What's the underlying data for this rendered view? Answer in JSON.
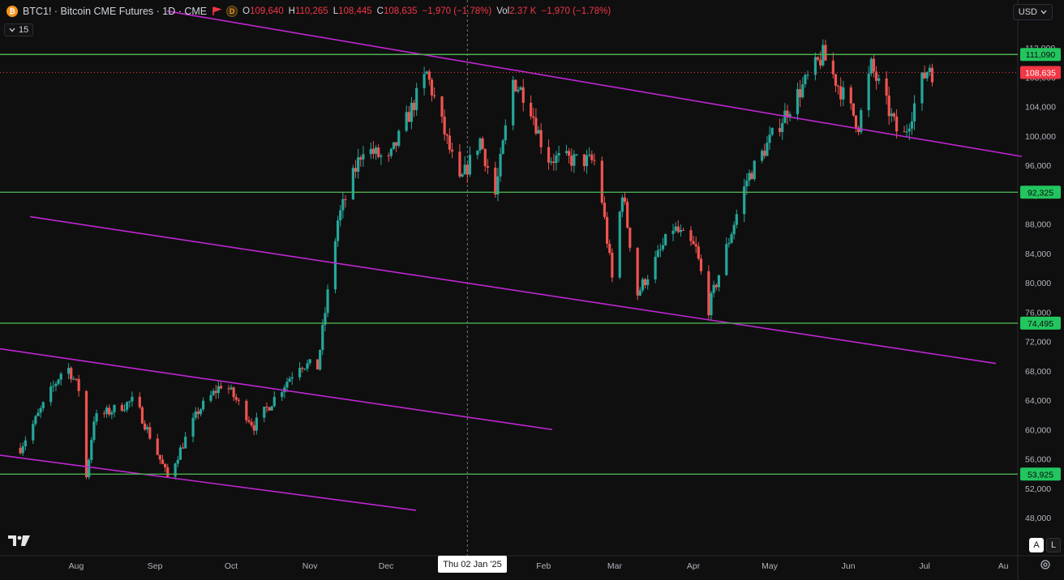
{
  "header": {
    "symbol_title": "BTC1! · Bitcoin CME Futures · 1D · CME",
    "coin_badge": "₿",
    "d_badge": "D",
    "open_label": "O",
    "open_value": "109,640",
    "high_label": "H",
    "high_value": "110,265",
    "low_label": "L",
    "low_value": "108,445",
    "close_label": "C",
    "close_value": "108,635",
    "change": "−1,970 (−1.78%)",
    "vol_label": "Vol",
    "vol_value": "2.37 K",
    "vol_change": "−1,970 (−1.78%)"
  },
  "interval_chip": {
    "label": "15"
  },
  "currency_button": {
    "label": "USD"
  },
  "crosshair_date": "Thu 02 Jan '25",
  "corner_buttons": {
    "auto": "A",
    "log": "L"
  },
  "colors": {
    "up": "#26a69a",
    "down": "#ef5350",
    "support": "#4caf50",
    "channel": "#c026d3",
    "price_tag": "#f23645"
  },
  "chart_data": {
    "type": "candlestick",
    "y_axis_ticks": [
      112000,
      108000,
      104000,
      100000,
      96000,
      92000,
      88000,
      84000,
      80000,
      76000,
      72000,
      68000,
      64000,
      60000,
      56000,
      52000,
      48000
    ],
    "y_tick_labels": [
      "112,000",
      "108,000",
      "104,000",
      "100,000",
      "96,000",
      "92,000",
      "88,000",
      "84,000",
      "80,000",
      "76,000",
      "72,000",
      "68,000",
      "64,000",
      "60,000",
      "56,000",
      "52,000",
      "48,000"
    ],
    "x_axis_labels": [
      "Aug",
      "Sep",
      "Oct",
      "Nov",
      "Dec",
      "Feb",
      "Mar",
      "Apr",
      "May",
      "Jun",
      "Jul",
      "Au"
    ],
    "horizontal_levels": [
      {
        "value": 111090,
        "label": "111,090"
      },
      {
        "value": 92325,
        "label": "92,325"
      },
      {
        "value": 74495,
        "label": "74,495"
      },
      {
        "value": 53925,
        "label": "53,925"
      }
    ],
    "last_price": {
      "value": 108635,
      "label": "108,635"
    },
    "trendlines": [
      {
        "from": [
          "Jan 2024",
          117000
        ],
        "to": [
          "Aug 2025",
          97200
        ]
      },
      {
        "from": [
          "Jul 2024",
          89000
        ],
        "to": [
          "Aug 2025",
          69000
        ]
      },
      {
        "from": [
          "Jul 2024",
          71000
        ],
        "to": [
          "Feb 2025",
          60000
        ]
      },
      {
        "from": [
          "Jul 2024",
          56500
        ],
        "to": [
          "Dec 2024",
          49000
        ]
      }
    ],
    "path": [
      [
        "Jul 10 2024",
        57500
      ],
      [
        "Jul 28 2024",
        69000
      ],
      [
        "Aug 2 2024",
        65500
      ],
      [
        "Aug 5 2024",
        53500
      ],
      [
        "Aug 8 2024",
        61500
      ],
      [
        "Aug 24 2024",
        64000
      ],
      [
        "Sep 6 2024",
        53500
      ],
      [
        "Sep 18 2024",
        62500
      ],
      [
        "Sep 28 2024",
        66500
      ],
      [
        "Oct 10 2024",
        60500
      ],
      [
        "Oct 28 2024",
        69000
      ],
      [
        "Nov 4 2024",
        68500
      ],
      [
        "Nov 12 2024",
        88500
      ],
      [
        "Nov 22 2024",
        98500
      ],
      [
        "Dec 2 2024",
        96500
      ],
      [
        "Dec 17 2024",
        108500
      ],
      [
        "Dec 30 2024",
        93500
      ],
      [
        "Jan 7 2025",
        99500
      ],
      [
        "Jan 13 2025",
        92000
      ],
      [
        "Jan 20 2025",
        107500
      ],
      [
        "Jan 26 2025",
        105000
      ],
      [
        "Feb 2 2025",
        97000
      ],
      [
        "Feb 22 2025",
        96500
      ],
      [
        "Feb 28 2025",
        80500
      ],
      [
        "Mar 4 2025",
        92500
      ],
      [
        "Mar 10 2025",
        78500
      ],
      [
        "Mar 24 2025",
        87500
      ],
      [
        "Apr 2 2025",
        84500
      ],
      [
        "Apr 7 2025",
        76500
      ],
      [
        "Apr 22 2025",
        94000
      ],
      [
        "May 8 2025",
        103500
      ],
      [
        "May 22 2025",
        111000
      ],
      [
        "Jun 5 2025",
        101500
      ],
      [
        "Jun 10 2025",
        109500
      ],
      [
        "Jun 22 2025",
        99000
      ],
      [
        "Jun 30 2025",
        107500
      ],
      [
        "Jul 3 2025",
        109640
      ],
      [
        "Jul 4 2025",
        108635
      ]
    ]
  }
}
